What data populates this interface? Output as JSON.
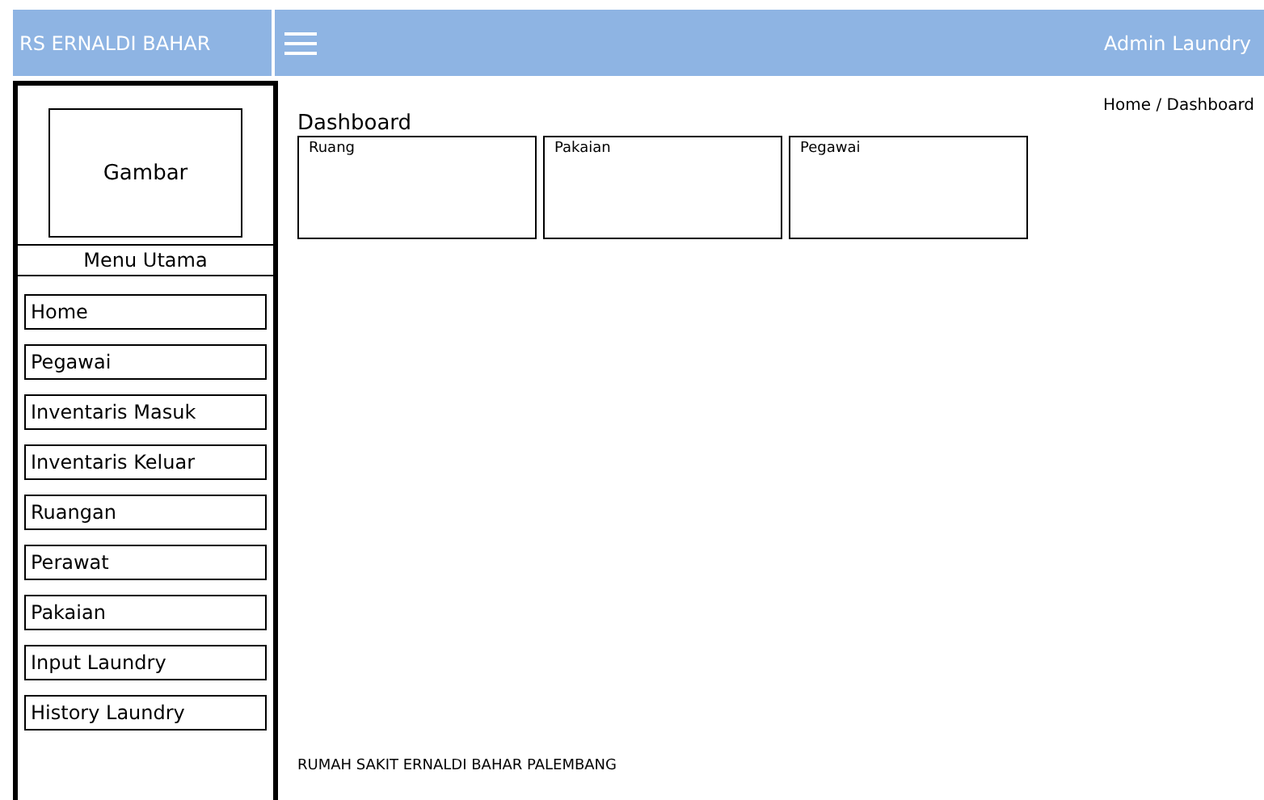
{
  "header": {
    "brand": "RS ERNALDI BAHAR",
    "user": "Admin Laundry"
  },
  "sidebar": {
    "image_label": "Gambar",
    "menu_title": "Menu Utama",
    "items": [
      {
        "label": "Home"
      },
      {
        "label": "Pegawai"
      },
      {
        "label": "Inventaris Masuk"
      },
      {
        "label": "Inventaris Keluar"
      },
      {
        "label": "Ruangan"
      },
      {
        "label": "Perawat"
      },
      {
        "label": "Pakaian"
      },
      {
        "label": "Input Laundry"
      },
      {
        "label": "History Laundry"
      }
    ]
  },
  "content": {
    "title": "Dashboard",
    "breadcrumb": "Home / Dashboard",
    "cards": [
      {
        "label": "Ruang"
      },
      {
        "label": "Pakaian"
      },
      {
        "label": "Pegawai"
      }
    ],
    "footer": "RUMAH SAKIT ERNALDI BAHAR PALEMBANG"
  }
}
